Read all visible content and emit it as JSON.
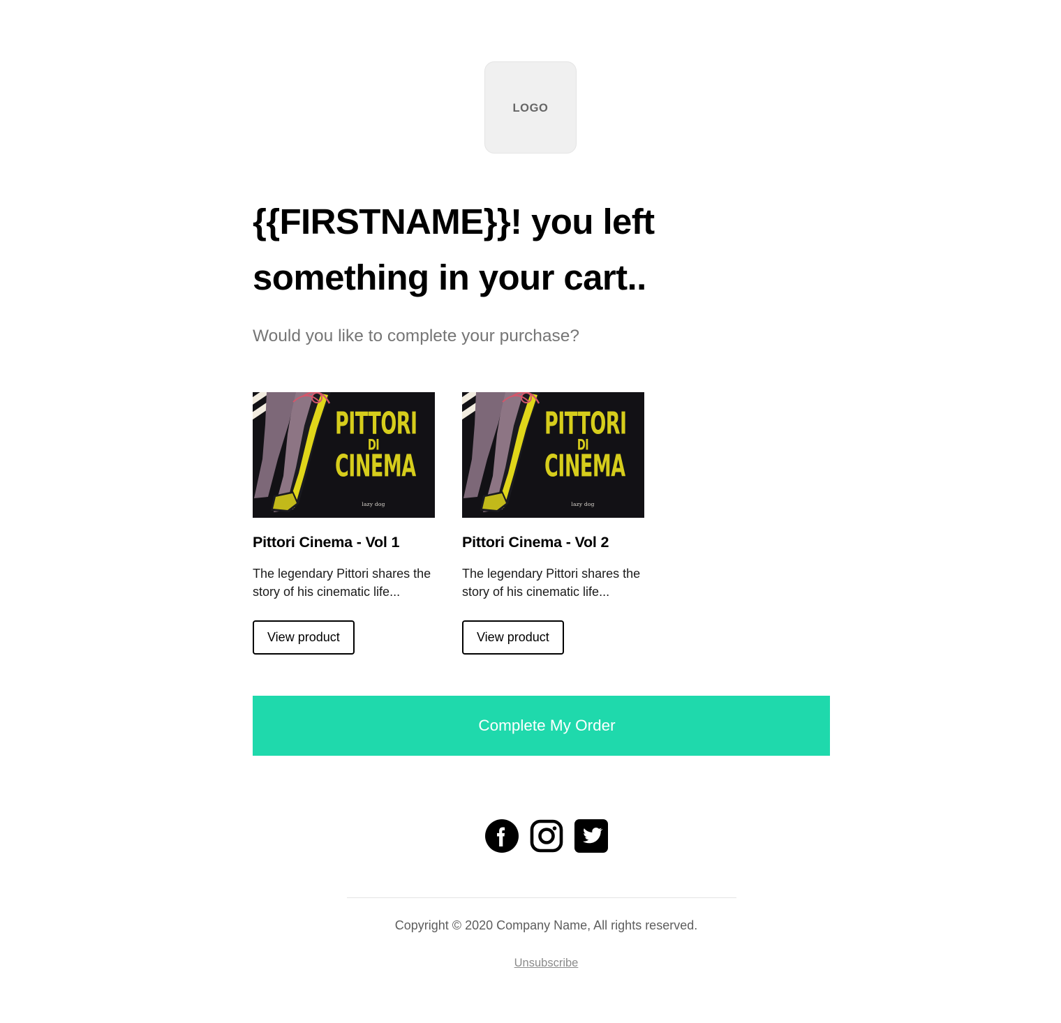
{
  "page": {
    "background_color": "#ffffff",
    "accent_color": "#1fd9ac"
  },
  "header": {
    "logo_label": "LOGO"
  },
  "hero": {
    "headline": "{{FIRSTNAME}}! you left something in your cart..",
    "subheadline": "Would you like to complete your purchase?"
  },
  "products": [
    {
      "title": "Pittori Cinema - Vol 1",
      "description": "The legendary Pittori shares the story of his cinematic life...",
      "button_label": "View product",
      "cover": {
        "line1": "PITTORI",
        "line2": "DI",
        "line3": "CINEMA",
        "credit": "lazy dog",
        "background_color": "#121115",
        "title_color": "#d6cd1c"
      }
    },
    {
      "title": "Pittori Cinema - Vol 2",
      "description": "The legendary Pittori shares the story of his cinematic life...",
      "button_label": "View product",
      "cover": {
        "line1": "PITTORI",
        "line2": "DI",
        "line3": "CINEMA",
        "credit": "lazy dog",
        "background_color": "#121115",
        "title_color": "#d6cd1c"
      }
    }
  ],
  "cta": {
    "label": "Complete My Order"
  },
  "social": [
    {
      "name": "facebook",
      "icon": "facebook-icon"
    },
    {
      "name": "instagram",
      "icon": "instagram-icon"
    },
    {
      "name": "twitter",
      "icon": "twitter-icon"
    }
  ],
  "footer": {
    "copyright": "Copyright © 2020 Company Name, All rights reserved.",
    "unsubscribe_label": "Unsubscribe"
  }
}
